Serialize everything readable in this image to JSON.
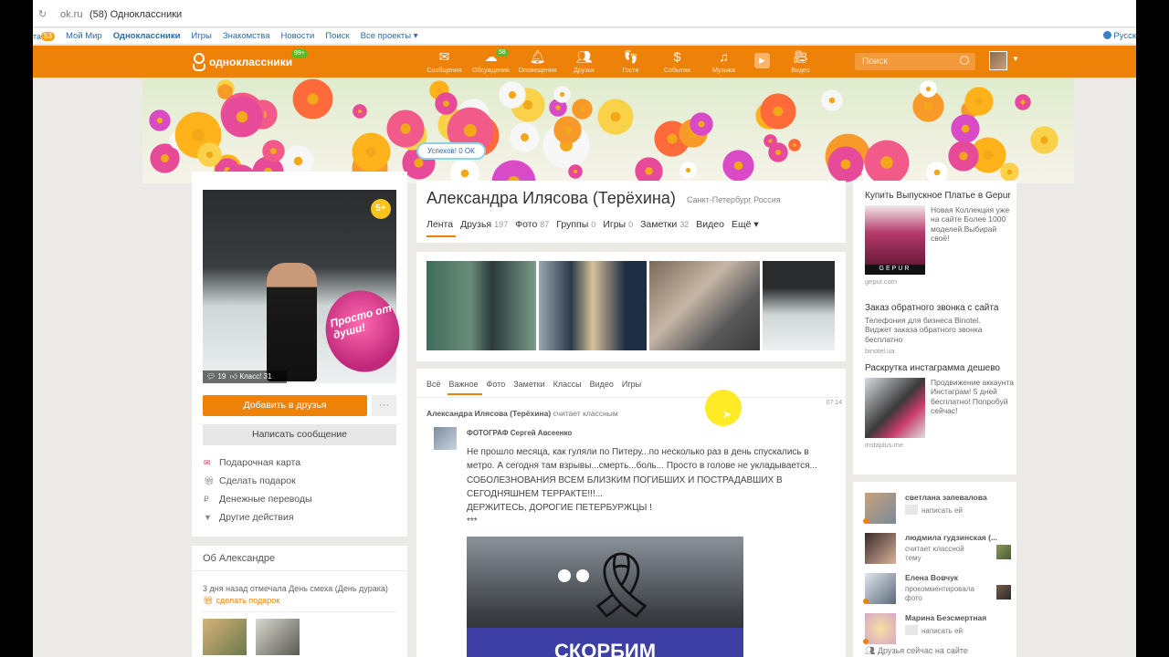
{
  "browser": {
    "url": "ok.ru",
    "title": "(58) Одноклассники"
  },
  "portal": {
    "cut_label": "та",
    "badge": "53",
    "items": [
      "Мой Мир",
      "Одноклассники",
      "Игры",
      "Знакомства",
      "Новости",
      "Поиск",
      "Все проекты ▾"
    ],
    "lang": "Русск"
  },
  "topbar": {
    "logo": "одноклассники",
    "logo_tag": "99+",
    "nav": [
      {
        "label": "Сообщения",
        "icon": "envelope-icon"
      },
      {
        "label": "Обсуждения",
        "icon": "chat-icon",
        "count": "58"
      },
      {
        "label": "Оповещения",
        "icon": "bell-icon"
      },
      {
        "label": "Друзья",
        "icon": "friends-icon"
      },
      {
        "label": "Гости",
        "icon": "footprints-icon"
      },
      {
        "label": "События",
        "icon": "events-icon"
      },
      {
        "label": "Музыка",
        "icon": "music-icon"
      },
      {
        "label": "Видео",
        "icon": "video-icon"
      }
    ],
    "search_placeholder": "Поиск"
  },
  "banner": {
    "success": "Успехов! 0 ОК"
  },
  "profile": {
    "photo_badge": "5+",
    "sticker_text": "Просто от души!",
    "photo_stats": {
      "comments": "19",
      "klass": "Класс! 31"
    },
    "add_friend": "Добавить в друзья",
    "more": "···",
    "send_message": "Написать сообщение",
    "actions": [
      "Подарочная карта",
      "Сделать подарок",
      "Денежные переводы",
      "Другие действия"
    ],
    "about_title": "Об Александре",
    "about_text": "3 дня назад отмечала День смеха (День дурака)",
    "about_gift": "сделать подарок"
  },
  "main": {
    "name": "Александра Илясова (Терёхина)",
    "city": "Санкт-Петербург Россия",
    "tabs": [
      {
        "label": "Лента",
        "count": ""
      },
      {
        "label": "Друзья",
        "count": "197"
      },
      {
        "label": "Фото",
        "count": "87"
      },
      {
        "label": "Группы",
        "count": "0"
      },
      {
        "label": "Игры",
        "count": "0"
      },
      {
        "label": "Заметки",
        "count": "32"
      },
      {
        "label": "Видео",
        "count": ""
      },
      {
        "label": "Ещё ▾",
        "count": ""
      }
    ]
  },
  "feed": {
    "tabs": [
      "Всё",
      "Важное",
      "Фото",
      "Заметки",
      "Классы",
      "Видео",
      "Игры"
    ],
    "time": "07:14",
    "author": "Александра Илясова (Терёхина)",
    "action": "считает классным",
    "post_author": "ФОТОГРАФ Сергей Авсеенко",
    "post_lines": [
      "Не прошло месяца, как гуляли по Питеру...по несколько раз в день спускались в",
      "метро. А сегодня там взрывы...смерть...боль... Просто в голове не укладывается...",
      "СОБОЛЕЗНОВАНИЯ ВСЕМ БЛИЗКИМ ПОГИБШИХ И ПОСТРАДАВШИХ В",
      "СЕГОДНЯШНЕМ ТЕРРАКТЕ!!!...",
      "ДЕРЖИТЕСЬ, ДОРОГИЕ ПЕТЕРБУРЖЦЫ !",
      "***"
    ],
    "image_text": "СКОРБИМ"
  },
  "ads": [
    {
      "title": "Купить Выпускное Платье в Gepur",
      "desc": "Новая Коллекция уже на сайте Более 1000 моделей.Выбирай своё!",
      "source": "gepur.com",
      "brand": "GEPUR"
    },
    {
      "title": "Заказ обратного звонка с сайта",
      "desc": "Телефония для бизнеса Binotel. Виджет заказа обратного звонка бесплатно",
      "source": "binotel.ua"
    },
    {
      "title": "Раскрутка инстаграмма дешево",
      "desc": "Продвижение аккаунта Инстаграм! 5 дней бесплатно! Попробуй сейчас!",
      "source": "instaplus.me"
    }
  ],
  "friends": [
    {
      "name": "светлана запевалова",
      "text": "написать ей"
    },
    {
      "name": "людмила гудзинская (...",
      "text": "считает классной тему"
    },
    {
      "name": "Елена Вовчук",
      "text": "прокомментировала фото"
    },
    {
      "name": "Марина Безсмертная",
      "text": "написать ей"
    }
  ],
  "friends_online": "Друзья сейчас на сайте",
  "colors": {
    "accent": "#ee8208",
    "link": "#2a6aa8",
    "online": "#5bb82a"
  }
}
